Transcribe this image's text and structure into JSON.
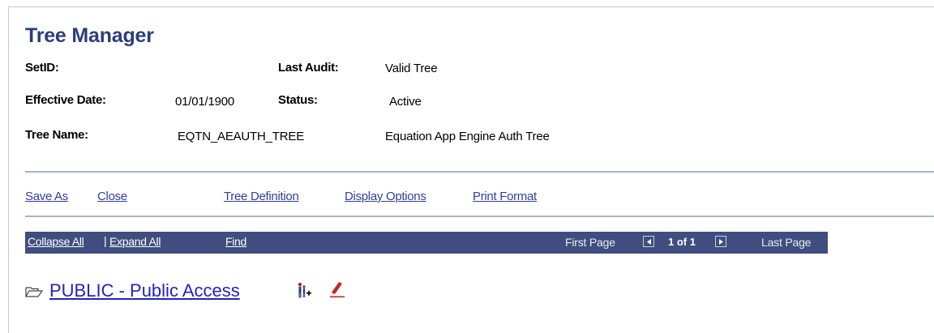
{
  "page": {
    "title": "Tree Manager"
  },
  "header": {
    "setid_label": "SetID:",
    "setid_value": "",
    "last_audit_label": "Last Audit:",
    "last_audit_value": "Valid Tree",
    "effective_date_label": "Effective Date:",
    "effective_date_value": "01/01/1900",
    "status_label": "Status:",
    "status_value": "Active",
    "tree_name_label": "Tree Name:",
    "tree_name_value": "EQTN_AEAUTH_TREE",
    "tree_description": "Equation App Engine Auth Tree"
  },
  "actions": {
    "save_as": "Save As",
    "close": "Close",
    "tree_definition": "Tree Definition",
    "display_options": "Display Options",
    "print_format": "Print Format"
  },
  "navbar": {
    "collapse_all": "Collapse All",
    "separator": "|",
    "expand_all": "Expand All",
    "find": "Find",
    "first_page": "First Page",
    "page_indicator": "1 of 1",
    "last_page": "Last Page"
  },
  "tree": {
    "root_node": "PUBLIC - Public Access"
  },
  "icons": {
    "folder": "folder-open-icon",
    "insert_child": "insert-child-icon",
    "edit": "edit-pencil-icon",
    "prev": "prev-page-icon",
    "next": "next-page-icon"
  },
  "colors": {
    "title": "#2b3e7a",
    "link": "#33409a",
    "navbar_bg": "#3f4e7e",
    "node_link": "#2323c0",
    "rule": "#a7b3cc"
  }
}
